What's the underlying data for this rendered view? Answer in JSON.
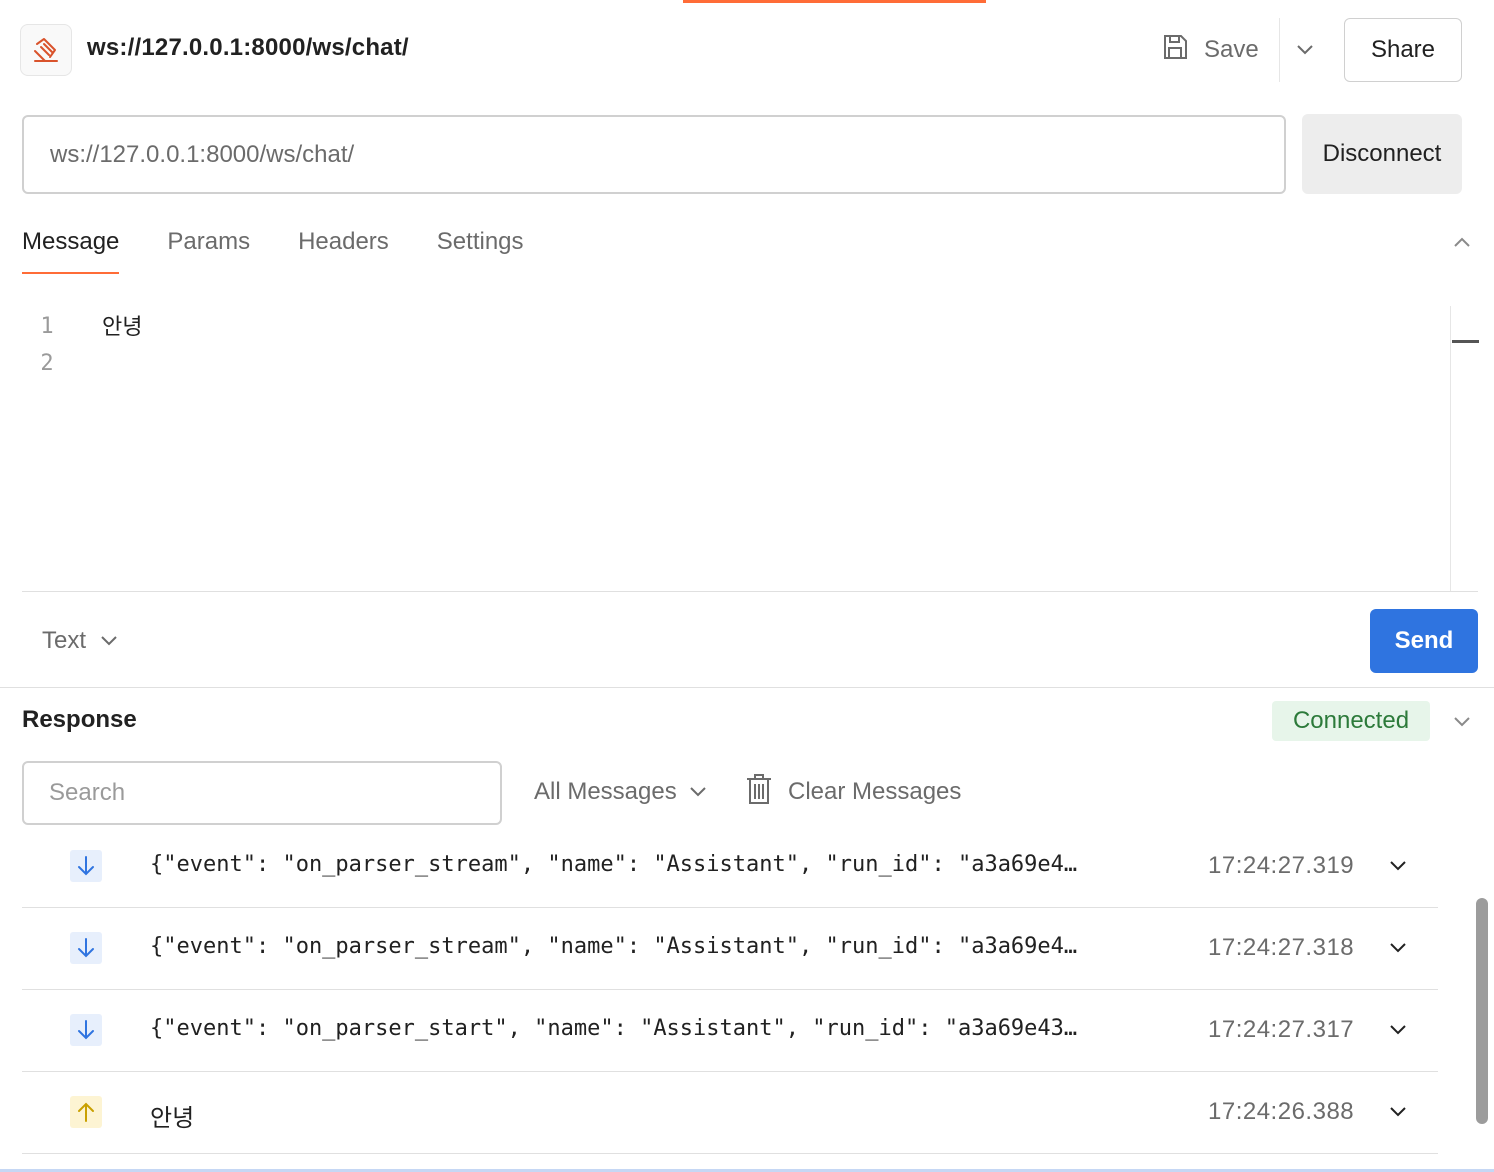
{
  "header": {
    "title": "ws://127.0.0.1:8000/ws/chat/",
    "save_label": "Save",
    "share_label": "Share"
  },
  "url_bar": {
    "value": "ws://127.0.0.1:8000/ws/chat/",
    "connect_button": "Disconnect"
  },
  "tabs": [
    {
      "label": "Message",
      "active": true
    },
    {
      "label": "Params",
      "active": false
    },
    {
      "label": "Headers",
      "active": false
    },
    {
      "label": "Settings",
      "active": false
    }
  ],
  "editor": {
    "line_numbers": [
      "1",
      "2"
    ],
    "lines": [
      "안녕",
      ""
    ]
  },
  "composer": {
    "format": "Text",
    "send_label": "Send"
  },
  "response": {
    "title": "Response",
    "status": "Connected",
    "search_placeholder": "Search",
    "filter": "All Messages",
    "clear_label": "Clear Messages",
    "messages": [
      {
        "direction": "incoming",
        "text": "{\"event\": \"on_parser_stream\", \"name\": \"Assistant\", \"run_id\": \"a3a69e4…",
        "time": "17:24:27.319"
      },
      {
        "direction": "incoming",
        "text": "{\"event\": \"on_parser_stream\", \"name\": \"Assistant\", \"run_id\": \"a3a69e4…",
        "time": "17:24:27.318"
      },
      {
        "direction": "incoming",
        "text": "{\"event\": \"on_parser_start\", \"name\": \"Assistant\", \"run_id\": \"a3a69e43…",
        "time": "17:24:27.317"
      },
      {
        "direction": "outgoing",
        "text": "안녕",
        "time": "17:24:26.388"
      }
    ]
  },
  "colors": {
    "accent": "#ff6c37",
    "send": "#2f74e0",
    "connected_bg": "#e7f5ea",
    "connected_text": "#2c7a3a",
    "incoming_icon": "#2f74e0",
    "outgoing_icon": "#c9a000"
  },
  "icons": {
    "request_type": "websocket-icon",
    "save": "save-icon",
    "clear": "trash-icon",
    "incoming": "arrow-down-icon",
    "outgoing": "arrow-up-icon"
  }
}
